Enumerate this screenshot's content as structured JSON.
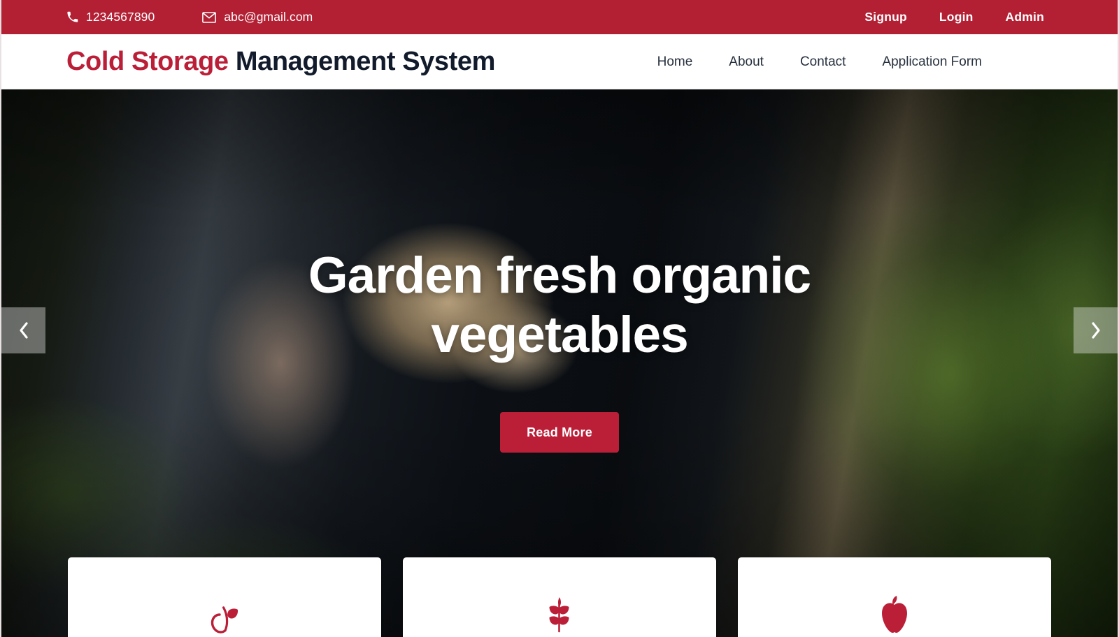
{
  "topbar": {
    "phone": {
      "icon": "phone-icon",
      "text": "1234567890"
    },
    "email": {
      "icon": "envelope-icon",
      "text": "abc@gmail.com"
    },
    "links": [
      {
        "name": "signup",
        "label": "Signup"
      },
      {
        "name": "login",
        "label": "Login"
      },
      {
        "name": "admin",
        "label": "Admin"
      }
    ],
    "background_color": "#b32034"
  },
  "navbar": {
    "brand": {
      "accent_text": "Cold Storage",
      "rest_text": " Management System"
    },
    "links": [
      {
        "name": "home",
        "label": "Home"
      },
      {
        "name": "about",
        "label": "About"
      },
      {
        "name": "contact",
        "label": "Contact"
      },
      {
        "name": "application-form",
        "label": "Application Form"
      }
    ],
    "brand_accent_color": "#bb1f38",
    "brand_text_color": "#121b2b"
  },
  "hero": {
    "headline": "Garden fresh organic vegetables",
    "cta_label": "Read More",
    "cta_color": "#bb1f38",
    "prev_icon": "chevron-left-icon",
    "next_icon": "chevron-right-icon",
    "image_description": "Hands holding freshly dug potatoes in a garden"
  },
  "cards": [
    {
      "name": "card-fruit",
      "icon": "apple-outline-leaf-icon",
      "icon_color": "#bb1f38"
    },
    {
      "name": "card-leaf",
      "icon": "leaf-sprig-icon",
      "icon_color": "#bb1f38"
    },
    {
      "name": "card-apple",
      "icon": "apple-solid-icon",
      "icon_color": "#bb1f38"
    }
  ]
}
